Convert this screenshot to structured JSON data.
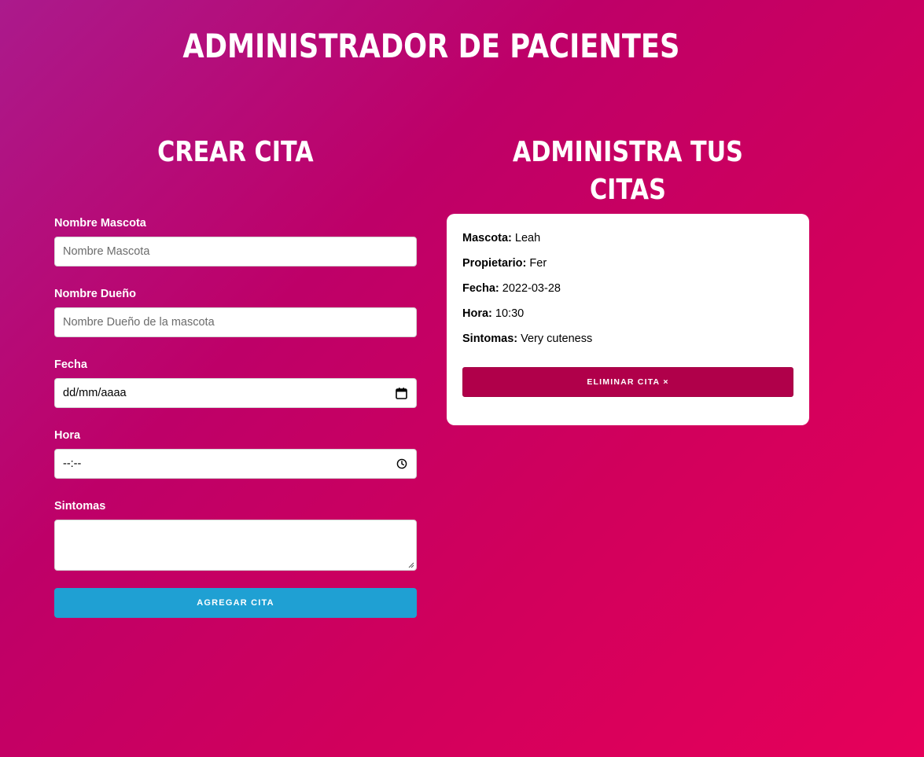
{
  "header": {
    "title": "ADMINISTRADOR DE PACIENTES"
  },
  "form": {
    "title": "CREAR CITA",
    "fields": {
      "pet": {
        "label": "Nombre Mascota",
        "placeholder": "Nombre Mascota",
        "value": ""
      },
      "owner": {
        "label": "Nombre Dueño",
        "placeholder": "Nombre Dueño de la mascota",
        "value": ""
      },
      "date": {
        "label": "Fecha",
        "display": "dd/mm/aaaa",
        "icon": "calendar-icon"
      },
      "time": {
        "label": "Hora",
        "display": "--:--",
        "icon": "clock-icon"
      },
      "symptoms": {
        "label": "Sintomas",
        "value": ""
      }
    },
    "submit_label": "AGREGAR CITA",
    "submit_color": "#1fa0d3"
  },
  "appointments": {
    "title": "ADMINISTRA TUS CITAS",
    "items": [
      {
        "pet_label": "Mascota:",
        "pet": "Leah",
        "owner_label": "Propietario:",
        "owner": "Fer",
        "date_label": "Fecha:",
        "date": "2022-03-28",
        "time_label": "Hora:",
        "time": "10:30",
        "symptoms_label": "Sintomas:",
        "symptoms": "Very cuteness",
        "delete_label": "ELIMINAR CITA",
        "delete_symbol": "×",
        "delete_color": "#b0004a"
      }
    ]
  }
}
